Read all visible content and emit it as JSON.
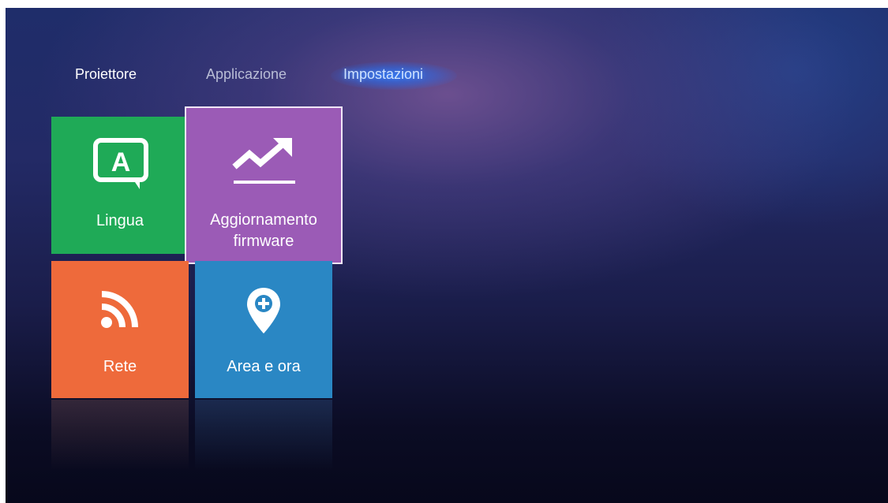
{
  "tabs": [
    {
      "label": "Proiettore",
      "selected": false
    },
    {
      "label": "Applicazione",
      "selected": false
    },
    {
      "label": "Impostazioni",
      "selected": true
    }
  ],
  "tiles": {
    "lingua": {
      "label": "Lingua",
      "icon": "language-icon",
      "color": "#1faa57"
    },
    "aggiornamento": {
      "label_line1": "Aggiornamento",
      "label_line2": "firmware",
      "icon": "trend-up-icon",
      "color": "#9b5bb6",
      "focused": true
    },
    "rete": {
      "label": "Rete",
      "icon": "wifi-signal-icon",
      "color": "#ee6a3b"
    },
    "area": {
      "label": "Area e ora",
      "icon": "location-pin-icon",
      "color": "#2a87c4"
    }
  },
  "colors": {
    "tab_active_glow": "#286ef0",
    "background_top": "#1f2d6a",
    "background_bottom": "#07081b"
  }
}
